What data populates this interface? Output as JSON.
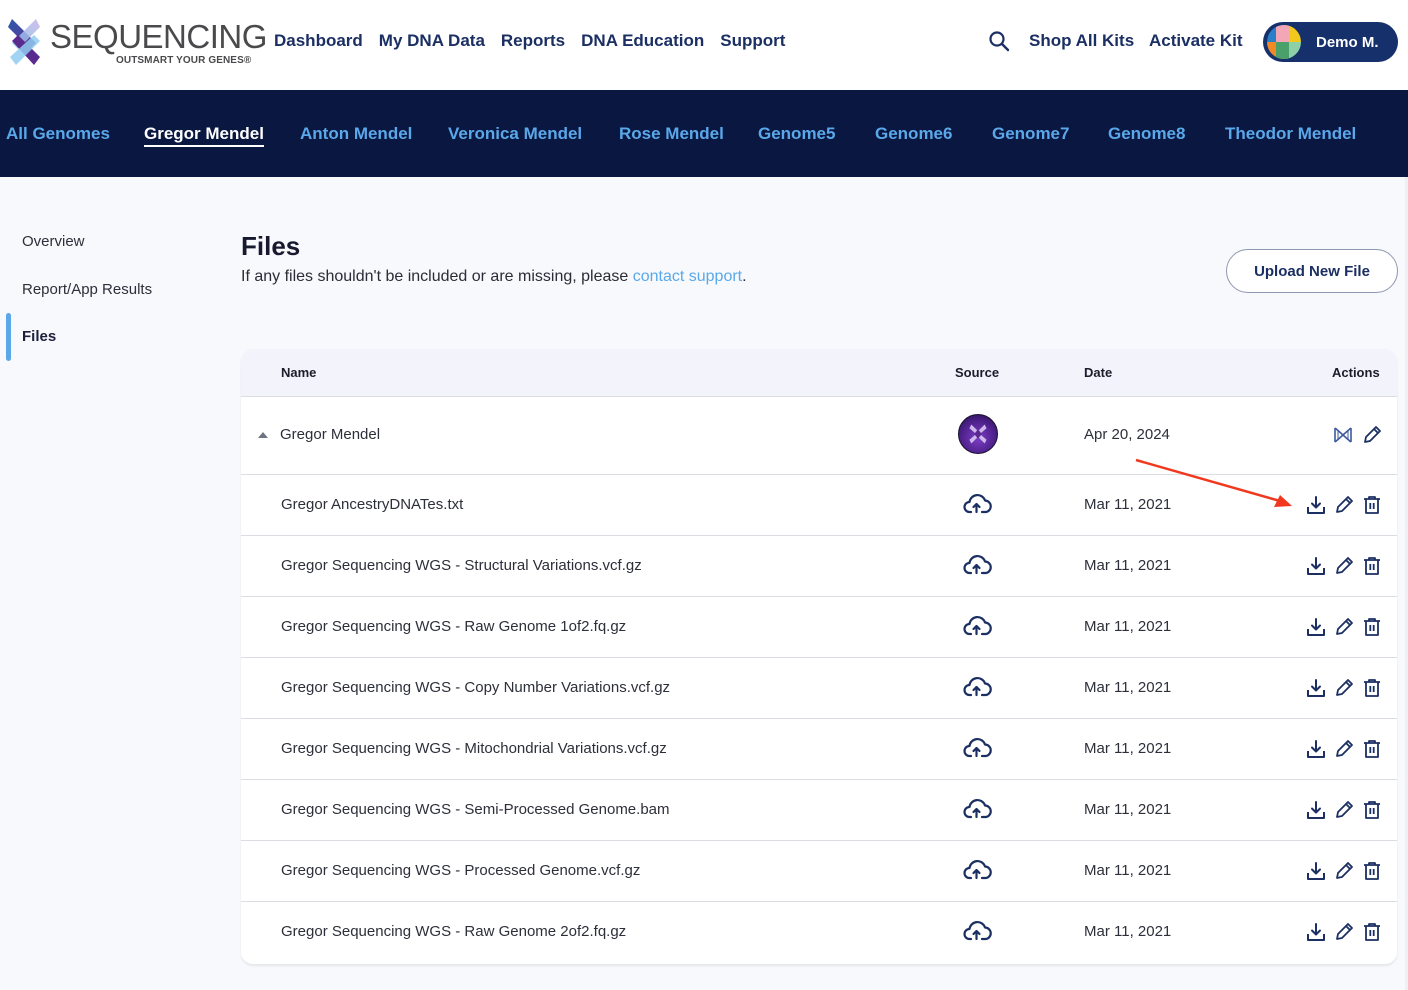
{
  "header": {
    "logo_word": "SEQUENCING",
    "logo_tagline": "OUTSMART YOUR GENES®",
    "nav": [
      "Dashboard",
      "My DNA Data",
      "Reports",
      "DNA Education",
      "Support"
    ],
    "search_icon": "search-icon",
    "shop_label": "Shop All Kits",
    "activate_label": "Activate Kit",
    "user_name": "Demo M."
  },
  "genome_tabs": {
    "items": [
      "All Genomes",
      "Gregor Mendel",
      "Anton Mendel",
      "Veronica Mendel",
      "Rose Mendel",
      "Genome5",
      "Genome6",
      "Genome7",
      "Genome8",
      "Theodor Mendel"
    ],
    "active": "Gregor Mendel"
  },
  "subnav": {
    "items": [
      "Overview",
      "Report/App Results",
      "Files"
    ],
    "active": "Files"
  },
  "page": {
    "title": "Files",
    "subtitle_prefix": "If any files shouldn't be included or are missing, please ",
    "subtitle_link": "contact support",
    "subtitle_suffix": ".",
    "upload_button": "Upload New File"
  },
  "table": {
    "columns": {
      "name": "Name",
      "source": "Source",
      "date": "Date",
      "actions": "Actions"
    },
    "group": {
      "name": "Gregor Mendel",
      "source_icon": "sequencing-logo-icon",
      "date": "Apr 20, 2024",
      "actions": [
        "dna-view-icon",
        "edit-icon"
      ],
      "expanded": true
    },
    "files": [
      {
        "name": "Gregor AncestryDNATes.txt",
        "source_icon": "cloud-upload-icon",
        "date": "Mar 11, 2021",
        "actions": [
          "download-icon",
          "edit-icon",
          "delete-icon"
        ]
      },
      {
        "name": "Gregor Sequencing WGS - Structural Variations.vcf.gz",
        "source_icon": "cloud-upload-icon",
        "date": "Mar 11, 2021",
        "actions": [
          "download-icon",
          "edit-icon",
          "delete-icon"
        ]
      },
      {
        "name": "Gregor Sequencing WGS - Raw Genome 1of2.fq.gz",
        "source_icon": "cloud-upload-icon",
        "date": "Mar 11, 2021",
        "actions": [
          "download-icon",
          "edit-icon",
          "delete-icon"
        ]
      },
      {
        "name": "Gregor Sequencing WGS - Copy Number Variations.vcf.gz",
        "source_icon": "cloud-upload-icon",
        "date": "Mar 11, 2021",
        "actions": [
          "download-icon",
          "edit-icon",
          "delete-icon"
        ]
      },
      {
        "name": "Gregor Sequencing WGS - Mitochondrial Variations.vcf.gz",
        "source_icon": "cloud-upload-icon",
        "date": "Mar 11, 2021",
        "actions": [
          "download-icon",
          "edit-icon",
          "delete-icon"
        ]
      },
      {
        "name": "Gregor Sequencing WGS - Semi-Processed Genome.bam",
        "source_icon": "cloud-upload-icon",
        "date": "Mar 11, 2021",
        "actions": [
          "download-icon",
          "edit-icon",
          "delete-icon"
        ]
      },
      {
        "name": "Gregor Sequencing WGS - Processed Genome.vcf.gz",
        "source_icon": "cloud-upload-icon",
        "date": "Mar 11, 2021",
        "actions": [
          "download-icon",
          "edit-icon",
          "delete-icon"
        ]
      },
      {
        "name": "Gregor Sequencing WGS - Raw Genome 2of2.fq.gz",
        "source_icon": "cloud-upload-icon",
        "date": "Mar 11, 2021",
        "actions": [
          "download-icon",
          "edit-icon",
          "delete-icon"
        ]
      }
    ]
  },
  "colors": {
    "navy": "#1b2f63",
    "band": "#0a1740",
    "accent_blue": "#5aa8ea",
    "annotation_red": "#f0391e"
  },
  "annotation": {
    "type": "arrow",
    "points_to": "download-icon of first file row"
  }
}
